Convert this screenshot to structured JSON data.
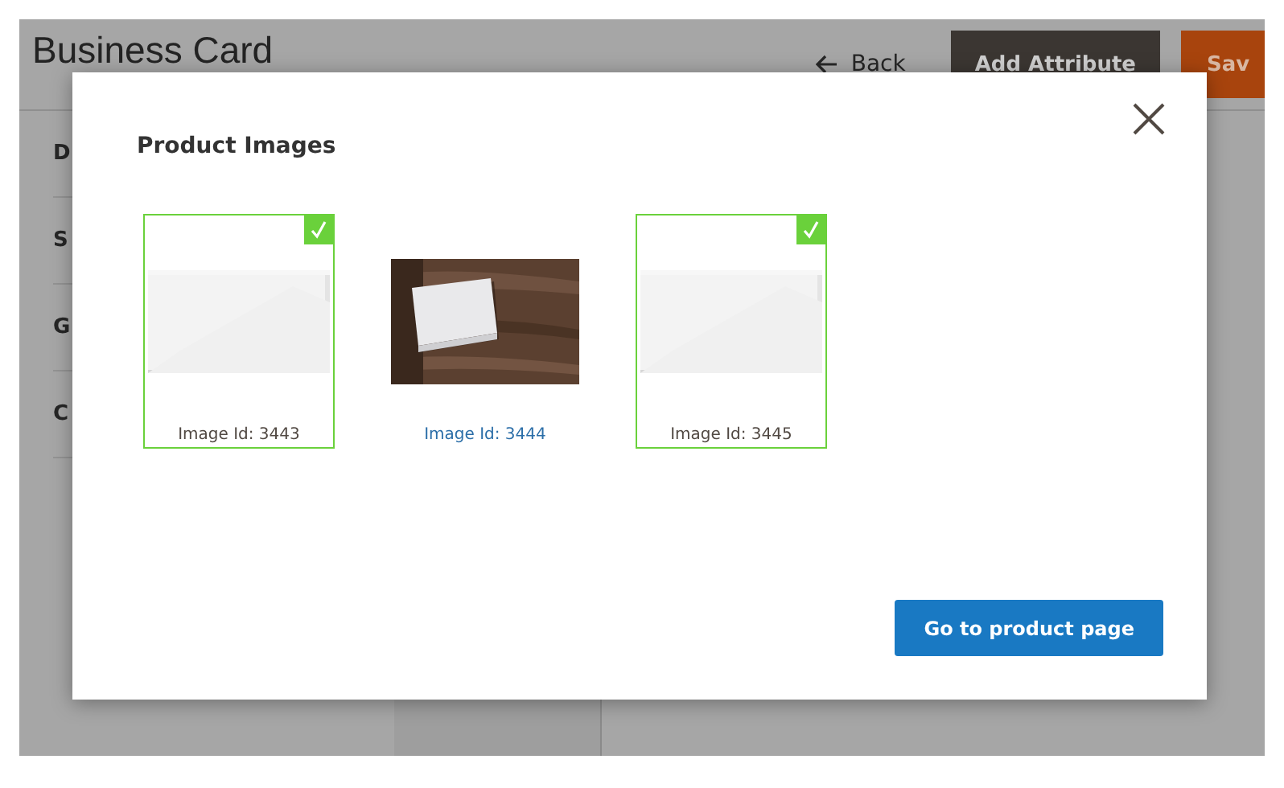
{
  "page": {
    "title": "Business Card",
    "back_link": "Back",
    "add_attribute_button": "Add Attribute",
    "save_button": "Sav",
    "sidebar_items": [
      "D",
      "S",
      "G",
      "C"
    ]
  },
  "modal": {
    "title": "Product Images",
    "images": [
      {
        "kind": "blank-card",
        "caption": "Image Id: 3443",
        "selected": true
      },
      {
        "kind": "card-on-wood",
        "caption": "Image Id: 3444",
        "selected": false
      },
      {
        "kind": "blank-card",
        "caption": "Image Id: 3445",
        "selected": true
      }
    ],
    "button": "Go to product page"
  }
}
